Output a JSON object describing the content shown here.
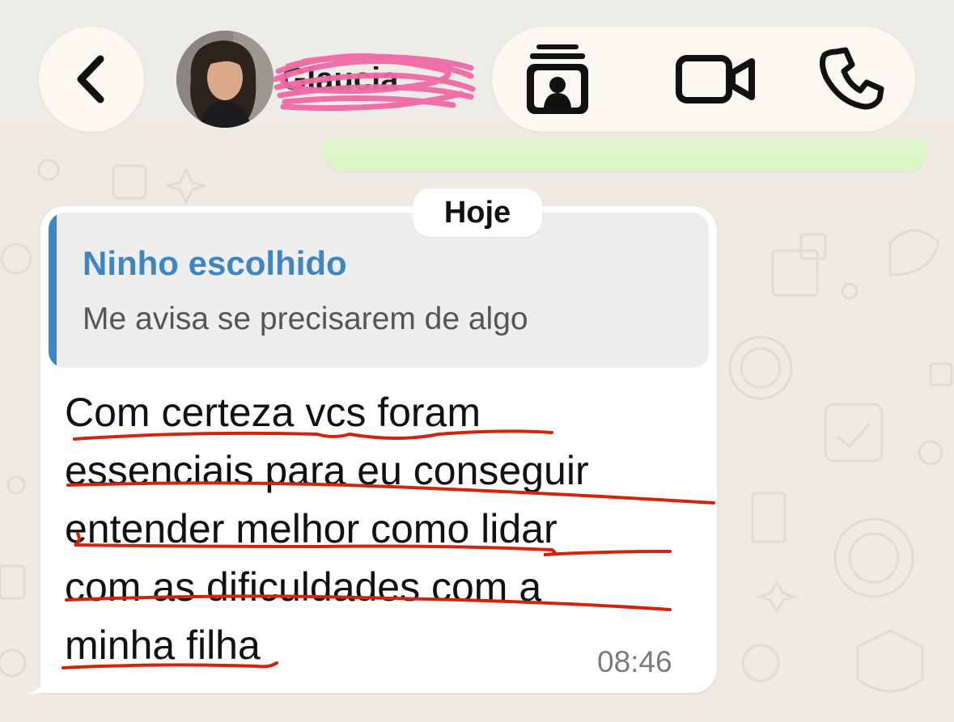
{
  "header": {
    "contact_name": "Glaucia",
    "back_icon": "chevron-left-icon",
    "actions": [
      {
        "name": "contact-card",
        "icon": "contact-card-icon"
      },
      {
        "name": "video-call",
        "icon": "video-camera-icon"
      },
      {
        "name": "voice-call",
        "icon": "phone-icon"
      }
    ]
  },
  "chat": {
    "date_label": "Hoje",
    "message": {
      "quoted_author": "Ninho escolhido",
      "quoted_text": "Me avisa se precisarem de algo",
      "lines": [
        "Com certeza vcs foram",
        "essenciais para eu conseguir",
        "entender melhor como lidar",
        "com as dificuldades com a",
        "minha filha"
      ],
      "time": "08:46"
    }
  },
  "colors": {
    "background": "#efeae2",
    "bubble": "#ffffff",
    "quote_accent": "#3e86c2",
    "underline": "#d0240f",
    "redaction": "#f06aa6",
    "sent_bubble": "#ddf6c8"
  }
}
